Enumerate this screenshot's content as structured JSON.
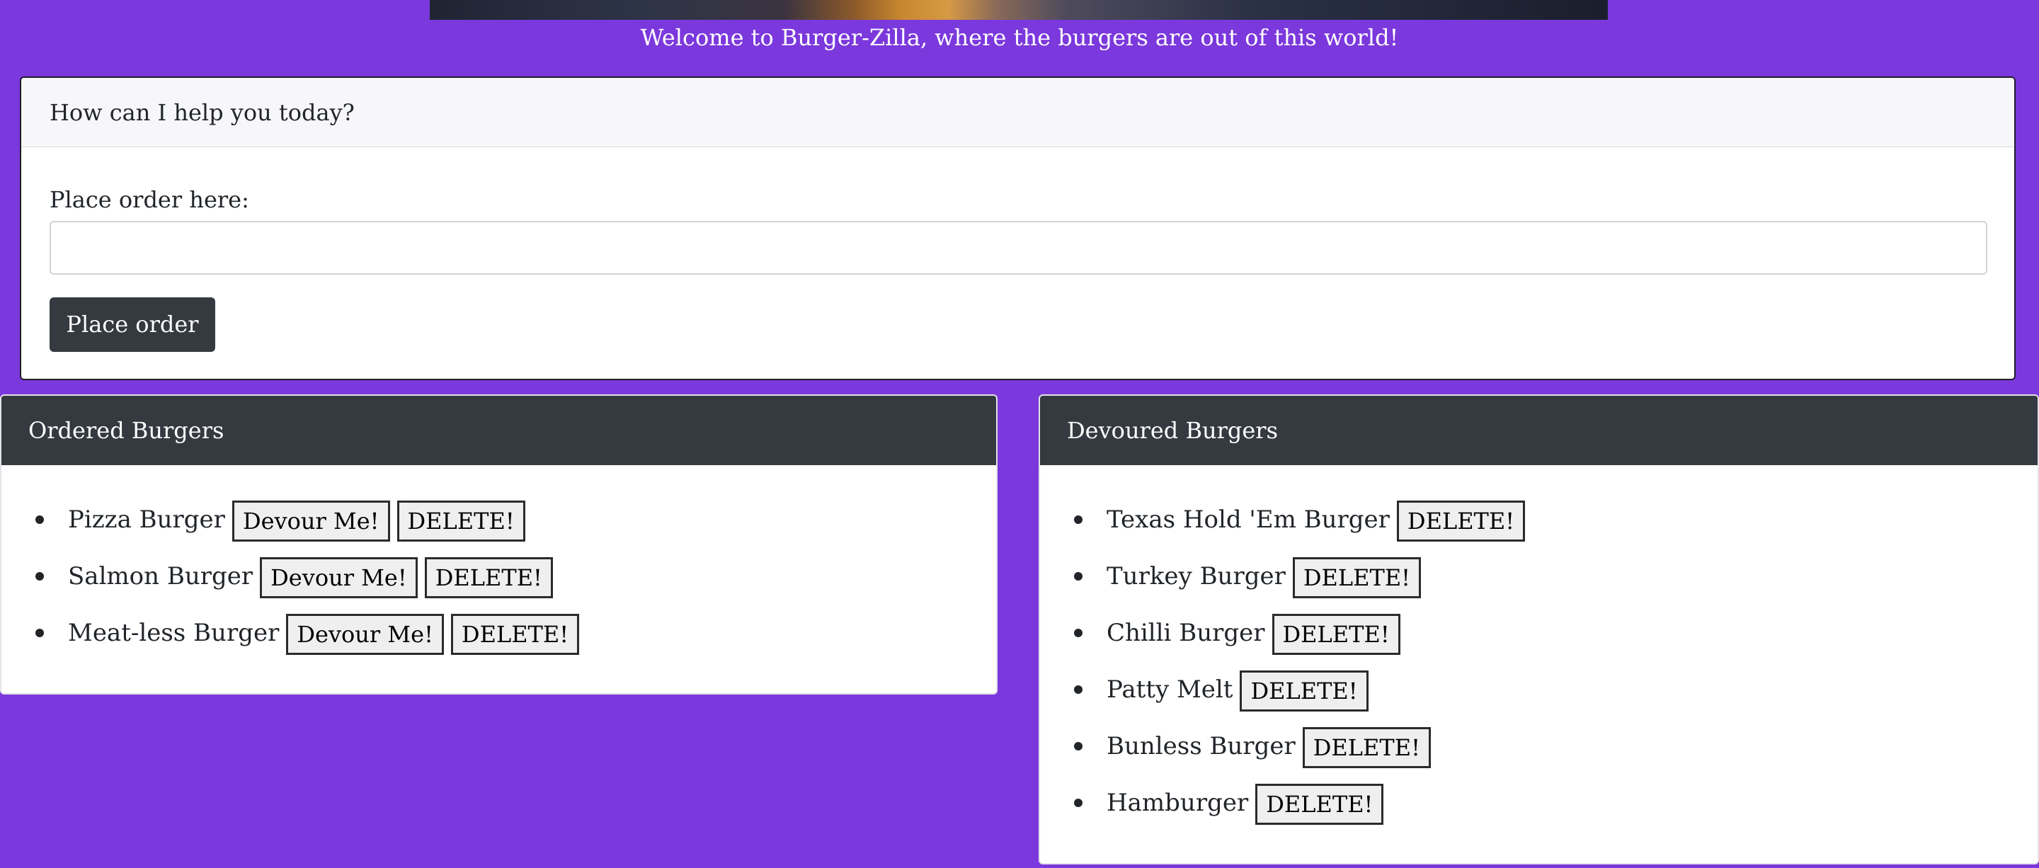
{
  "welcome": "Welcome to Burger-Zilla, where the burgers are out of this world!",
  "order_card": {
    "header": "How can I help you today?",
    "label": "Place order here:",
    "input_value": "",
    "button": "Place order"
  },
  "ordered": {
    "title": "Ordered Burgers",
    "items": [
      {
        "name": "Pizza Burger",
        "devour": "Devour Me!",
        "delete": "DELETE!"
      },
      {
        "name": "Salmon Burger",
        "devour": "Devour Me!",
        "delete": "DELETE!"
      },
      {
        "name": "Meat-less Burger",
        "devour": "Devour Me!",
        "delete": "DELETE!"
      }
    ]
  },
  "devoured": {
    "title": "Devoured Burgers",
    "items": [
      {
        "name": "Texas Hold 'Em Burger",
        "delete": "DELETE!"
      },
      {
        "name": "Turkey Burger",
        "delete": "DELETE!"
      },
      {
        "name": "Chilli Burger",
        "delete": "DELETE!"
      },
      {
        "name": "Patty Melt",
        "delete": "DELETE!"
      },
      {
        "name": "Bunless Burger",
        "delete": "DELETE!"
      },
      {
        "name": "Hamburger",
        "delete": "DELETE!"
      }
    ]
  },
  "colors": {
    "background": "#7b38dc",
    "header_dark": "#343a40",
    "button_dark": "#343a40"
  }
}
